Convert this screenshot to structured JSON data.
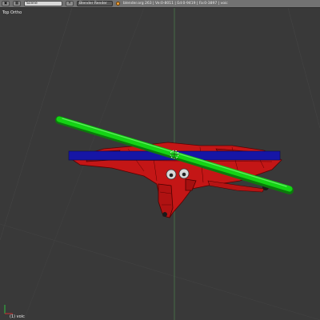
{
  "header": {
    "editor_menu_icon": "3d-view-menu-icon",
    "scene_field": "Scene",
    "render_engine": "Blender Render",
    "stats": "blender.org 263 | Ve:0-8011 | Ed:0-9419 | Fa:0-3897 | voic"
  },
  "viewport": {
    "view_name": "Top Ortho",
    "active_object": "(1) voic"
  },
  "colors": {
    "background": "#393939",
    "mesh": "#d01010",
    "mesh_wire": "#5a0000",
    "green_bar": "#10d010",
    "blue_bar": "#1414a8",
    "axis_x": "#d03030",
    "axis_y": "#30c040"
  }
}
